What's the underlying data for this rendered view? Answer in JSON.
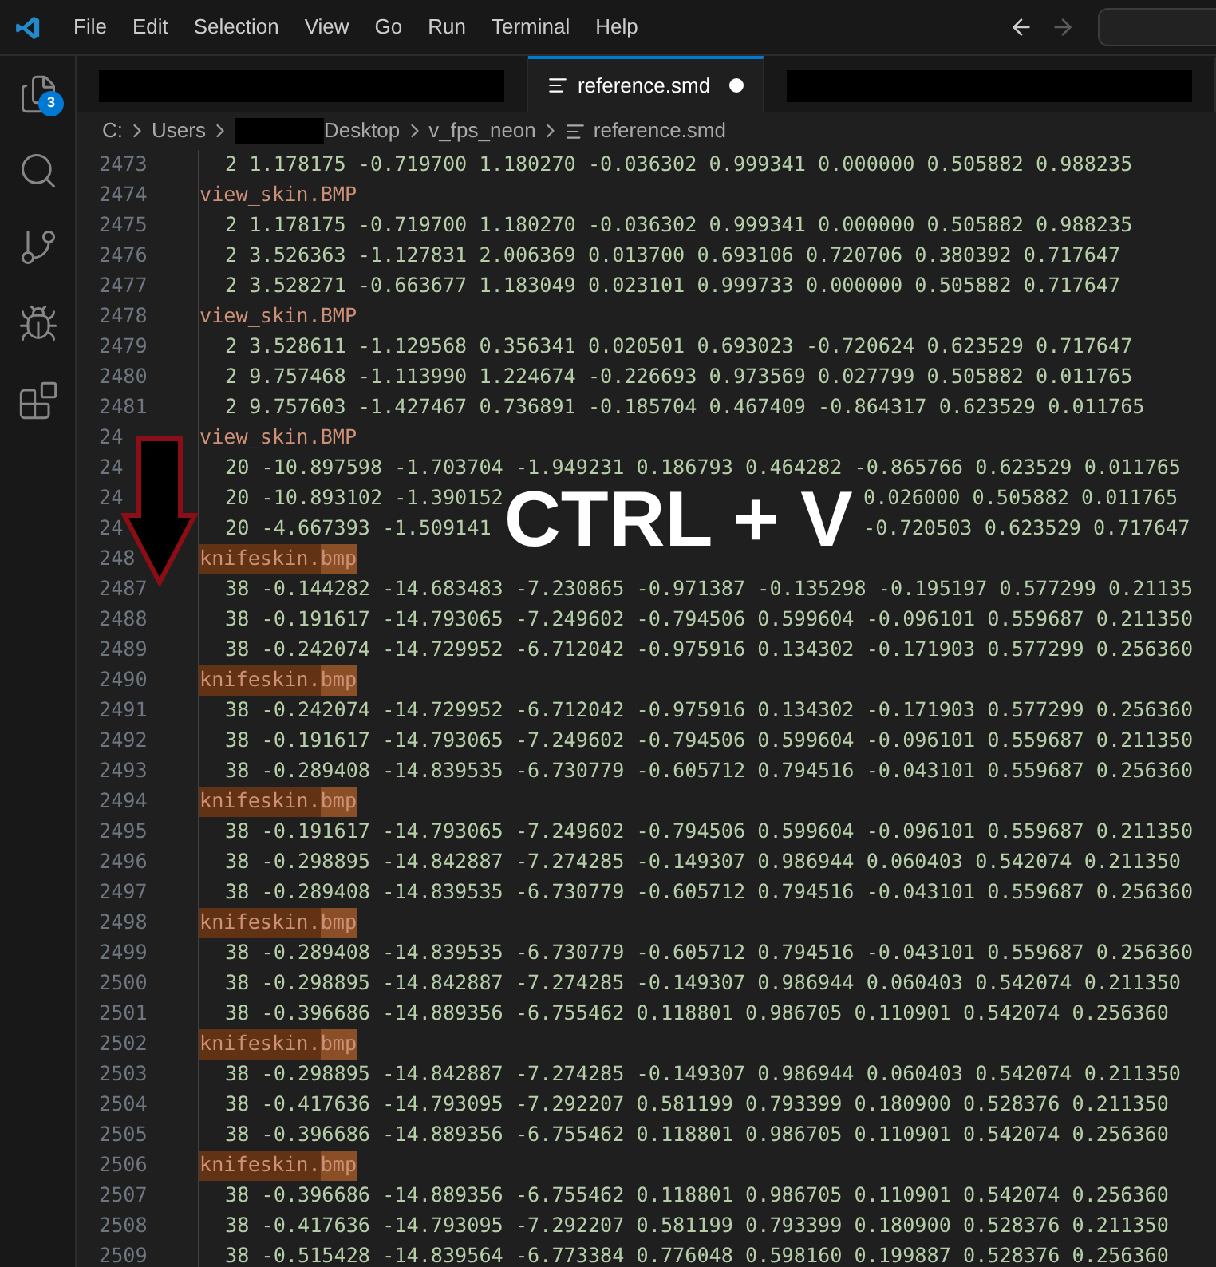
{
  "menu": [
    "File",
    "Edit",
    "Selection",
    "View",
    "Go",
    "Run",
    "Terminal",
    "Help"
  ],
  "nav": {
    "back_disabled": false,
    "forward_disabled": true
  },
  "activity_bar": [
    {
      "kind": "explorer",
      "badge": "3"
    },
    {
      "kind": "search"
    },
    {
      "kind": "source-control"
    },
    {
      "kind": "debug"
    },
    {
      "kind": "extensions"
    }
  ],
  "tabs": [
    {
      "kind": "redacted",
      "selected": false
    },
    {
      "kind": "file",
      "label": "reference.smd",
      "selected": true,
      "modified": true
    },
    {
      "kind": "redacted",
      "selected": false
    }
  ],
  "breadcrumb": [
    {
      "kind": "text",
      "label": "C:"
    },
    {
      "kind": "text",
      "label": "Users"
    },
    {
      "kind": "redacted",
      "label": "Desktop"
    },
    {
      "kind": "text",
      "label": "v_fps_neon"
    },
    {
      "kind": "file",
      "label": "reference.smd"
    }
  ],
  "lines": [
    {
      "n": "2473",
      "kind": "data",
      "text": "2 1.178175 -0.719700 1.180270 -0.036302 0.999341 0.000000 0.505882 0.988235"
    },
    {
      "n": "2474",
      "kind": "material",
      "name": "view_skin.",
      "ext": "BMP",
      "highlighted": false
    },
    {
      "n": "2475",
      "kind": "data",
      "text": "2 1.178175 -0.719700 1.180270 -0.036302 0.999341 0.000000 0.505882 0.988235"
    },
    {
      "n": "2476",
      "kind": "data",
      "text": "2 3.526363 -1.127831 2.006369 0.013700 0.693106 0.720706 0.380392 0.717647"
    },
    {
      "n": "2477",
      "kind": "data",
      "text": "2 3.528271 -0.663677 1.183049 0.023101 0.999733 0.000000 0.505882 0.717647"
    },
    {
      "n": "2478",
      "kind": "material",
      "name": "view_skin.",
      "ext": "BMP",
      "highlighted": false
    },
    {
      "n": "2479",
      "kind": "data",
      "text": "2 3.528611 -1.129568 0.356341 0.020501 0.693023 -0.720624 0.623529 0.717647"
    },
    {
      "n": "2480",
      "kind": "data",
      "text": "2 9.757468 -1.113990 1.224674 -0.226693 0.973569 0.027799 0.505882 0.011765"
    },
    {
      "n": "2481",
      "kind": "data",
      "text": "2 9.757603 -1.427467 0.736891 -0.185704 0.467409 -0.864317 0.623529 0.011765"
    },
    {
      "n": "24",
      "kind": "material",
      "name": "view_skin.",
      "ext": "BMP",
      "highlighted": false
    },
    {
      "n": "24",
      "kind": "data",
      "text": "20 -10.897598 -1.703704 -1.949231 0.186793 0.464282 -0.865766 0.623529 0.011765"
    },
    {
      "n": "24",
      "kind": "data",
      "text": "20 -10.893102 -1.390152",
      "text_right": "0.026000 0.505882 0.011765"
    },
    {
      "n": "24",
      "kind": "data",
      "text": "20 -4.667393 -1.509141",
      "text_right": "-0.720503 0.623529 0.717647"
    },
    {
      "n": "248",
      "kind": "material",
      "name": "knifeskin.",
      "ext": "bmp",
      "highlighted": true
    },
    {
      "n": "2487",
      "kind": "data",
      "text": "38 -0.144282 -14.683483 -7.230865 -0.971387 -0.135298 -0.195197 0.577299 0.21135"
    },
    {
      "n": "2488",
      "kind": "data",
      "text": "38 -0.191617 -14.793065 -7.249602 -0.794506 0.599604 -0.096101 0.559687 0.211350"
    },
    {
      "n": "2489",
      "kind": "data",
      "text": "38 -0.242074 -14.729952 -6.712042 -0.975916 0.134302 -0.171903 0.577299 0.256360"
    },
    {
      "n": "2490",
      "kind": "material",
      "name": "knifeskin.",
      "ext": "bmp",
      "highlighted": true
    },
    {
      "n": "2491",
      "kind": "data",
      "text": "38 -0.242074 -14.729952 -6.712042 -0.975916 0.134302 -0.171903 0.577299 0.256360"
    },
    {
      "n": "2492",
      "kind": "data",
      "text": "38 -0.191617 -14.793065 -7.249602 -0.794506 0.599604 -0.096101 0.559687 0.211350"
    },
    {
      "n": "2493",
      "kind": "data",
      "text": "38 -0.289408 -14.839535 -6.730779 -0.605712 0.794516 -0.043101 0.559687 0.256360"
    },
    {
      "n": "2494",
      "kind": "material",
      "name": "knifeskin.",
      "ext": "bmp",
      "highlighted": true
    },
    {
      "n": "2495",
      "kind": "data",
      "text": "38 -0.191617 -14.793065 -7.249602 -0.794506 0.599604 -0.096101 0.559687 0.211350"
    },
    {
      "n": "2496",
      "kind": "data",
      "text": "38 -0.298895 -14.842887 -7.274285 -0.149307 0.986944 0.060403 0.542074 0.211350"
    },
    {
      "n": "2497",
      "kind": "data",
      "text": "38 -0.289408 -14.839535 -6.730779 -0.605712 0.794516 -0.043101 0.559687 0.256360"
    },
    {
      "n": "2498",
      "kind": "material",
      "name": "knifeskin.",
      "ext": "bmp",
      "highlighted": true
    },
    {
      "n": "2499",
      "kind": "data",
      "text": "38 -0.289408 -14.839535 -6.730779 -0.605712 0.794516 -0.043101 0.559687 0.256360"
    },
    {
      "n": "2500",
      "kind": "data",
      "text": "38 -0.298895 -14.842887 -7.274285 -0.149307 0.986944 0.060403 0.542074 0.211350"
    },
    {
      "n": "2501",
      "kind": "data",
      "text": "38 -0.396686 -14.889356 -6.755462 0.118801 0.986705 0.110901 0.542074 0.256360"
    },
    {
      "n": "2502",
      "kind": "material",
      "name": "knifeskin.",
      "ext": "bmp",
      "highlighted": true
    },
    {
      "n": "2503",
      "kind": "data",
      "text": "38 -0.298895 -14.842887 -7.274285 -0.149307 0.986944 0.060403 0.542074 0.211350"
    },
    {
      "n": "2504",
      "kind": "data",
      "text": "38 -0.417636 -14.793095 -7.292207 0.581199 0.793399 0.180900 0.528376 0.211350"
    },
    {
      "n": "2505",
      "kind": "data",
      "text": "38 -0.396686 -14.889356 -6.755462 0.118801 0.986705 0.110901 0.542074 0.256360"
    },
    {
      "n": "2506",
      "kind": "material",
      "name": "knifeskin.",
      "ext": "bmp",
      "highlighted": true
    },
    {
      "n": "2507",
      "kind": "data",
      "text": "38 -0.396686 -14.889356 -6.755462 0.118801 0.986705 0.110901 0.542074 0.256360"
    },
    {
      "n": "2508",
      "kind": "data",
      "text": "38 -0.417636 -14.793095 -7.292207 0.581199 0.793399 0.180900 0.528376 0.211350"
    },
    {
      "n": "2509",
      "kind": "data",
      "text": "38 -0.515428 -14.839564 -6.773384 0.776048 0.598160 0.199887 0.528376 0.256360"
    }
  ],
  "overlay": {
    "caption": "CTRL + V"
  }
}
